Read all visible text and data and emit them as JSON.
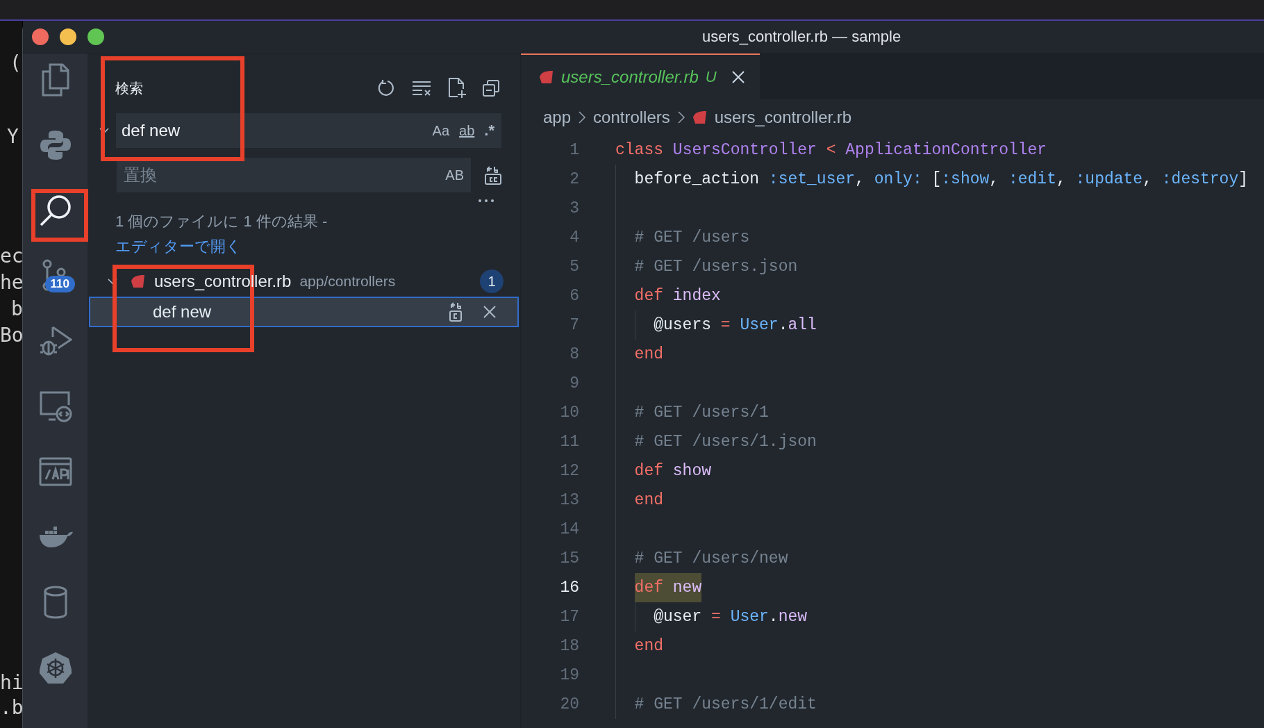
{
  "background_window": {
    "fragments": [
      "(",
      "Y",
      "ec",
      "he",
      "b",
      "Bo",
      "hi",
      ".b"
    ]
  },
  "window": {
    "title": "users_controller.rb — sample"
  },
  "activity_bar": [
    {
      "kind": "files",
      "selected": false
    },
    {
      "kind": "python",
      "selected": false
    },
    {
      "kind": "search",
      "selected": true
    },
    {
      "kind": "source_control",
      "selected": false,
      "badge": "110"
    },
    {
      "kind": "run_debug",
      "selected": false
    },
    {
      "kind": "remote",
      "selected": false
    },
    {
      "kind": "api",
      "selected": false
    },
    {
      "kind": "docker",
      "selected": false
    },
    {
      "kind": "database",
      "selected": false
    },
    {
      "kind": "kubernetes",
      "selected": false
    }
  ],
  "search_panel": {
    "title": "検索",
    "search": {
      "value": "def new",
      "toggles": [
        "Aa",
        "ab",
        ".*"
      ]
    },
    "replace_expanded": true,
    "replace": {
      "placeholder": "置換",
      "toggle": "AB"
    },
    "message": "1 個のファイルに 1 件の結果 -",
    "message_link": "エディターで開く",
    "files": [
      {
        "name": "users_controller.rb",
        "path": "app/controllers",
        "count": "1",
        "expanded": true,
        "matches": [
          {
            "text": "def new",
            "selected": true
          }
        ]
      }
    ]
  },
  "tabs": [
    {
      "name": "users_controller.rb",
      "status": "U",
      "selected": true
    }
  ],
  "breadcrumbs": [
    "app",
    "controllers",
    "users_controller.rb"
  ],
  "code": [
    {
      "n": "1",
      "current": false,
      "tokens": [
        {
          "kind": "kw",
          "text": "class "
        },
        {
          "kind": "cls",
          "text": "UsersController"
        },
        {
          "kind": "op",
          "text": " < "
        },
        {
          "kind": "cls",
          "text": "ApplicationController"
        }
      ]
    },
    {
      "n": "2",
      "current": false,
      "tokens": [
        {
          "kind": "plain",
          "text": "  before_action "
        },
        {
          "kind": "sym",
          "text": ":set_user"
        },
        {
          "kind": "plain",
          "text": ", "
        },
        {
          "kind": "sym",
          "text": "only:"
        },
        {
          "kind": "plain",
          "text": " ["
        },
        {
          "kind": "sym",
          "text": ":show"
        },
        {
          "kind": "plain",
          "text": ", "
        },
        {
          "kind": "sym",
          "text": ":edit"
        },
        {
          "kind": "plain",
          "text": ", "
        },
        {
          "kind": "sym",
          "text": ":update"
        },
        {
          "kind": "plain",
          "text": ", "
        },
        {
          "kind": "sym",
          "text": ":destroy"
        },
        {
          "kind": "plain",
          "text": "]"
        }
      ]
    },
    {
      "n": "3",
      "current": false
    },
    {
      "n": "4",
      "current": false,
      "tokens": [
        {
          "kind": "comment",
          "text": "  # GET /users"
        }
      ]
    },
    {
      "n": "5",
      "current": false,
      "tokens": [
        {
          "kind": "comment",
          "text": "  # GET /users.json"
        }
      ]
    },
    {
      "n": "6",
      "current": false,
      "tokens": [
        {
          "kind": "kw",
          "text": "  def "
        },
        {
          "kind": "fn",
          "text": "index"
        }
      ]
    },
    {
      "n": "7",
      "current": false,
      "tokens": [
        {
          "kind": "plain",
          "text": "    @users "
        },
        {
          "kind": "op",
          "text": "="
        },
        {
          "kind": "const",
          "text": " User"
        },
        {
          "kind": "plain",
          "text": "."
        },
        {
          "kind": "fn",
          "text": "all"
        }
      ]
    },
    {
      "n": "8",
      "current": false,
      "tokens": [
        {
          "kind": "kw",
          "text": "  end"
        }
      ]
    },
    {
      "n": "9",
      "current": false
    },
    {
      "n": "10",
      "current": false,
      "tokens": [
        {
          "kind": "comment",
          "text": "  # GET /users/1"
        }
      ]
    },
    {
      "n": "11",
      "current": false,
      "tokens": [
        {
          "kind": "comment",
          "text": "  # GET /users/1.json"
        }
      ]
    },
    {
      "n": "12",
      "current": false,
      "tokens": [
        {
          "kind": "kw",
          "text": "  def "
        },
        {
          "kind": "fn",
          "text": "show"
        }
      ]
    },
    {
      "n": "13",
      "current": false,
      "tokens": [
        {
          "kind": "kw",
          "text": "  end"
        }
      ]
    },
    {
      "n": "14",
      "current": false
    },
    {
      "n": "15",
      "current": false,
      "tokens": [
        {
          "kind": "comment",
          "text": "  # GET /users/new"
        }
      ]
    },
    {
      "n": "16",
      "current": true,
      "tokens": [
        {
          "kind": "kw",
          "text": "  def "
        },
        {
          "kind": "fn",
          "text": "new",
          "match": true
        }
      ]
    },
    {
      "n": "17",
      "current": false,
      "tokens": [
        {
          "kind": "plain",
          "text": "    @user "
        },
        {
          "kind": "op",
          "text": "="
        },
        {
          "kind": "const",
          "text": " User"
        },
        {
          "kind": "plain",
          "text": "."
        },
        {
          "kind": "fn",
          "text": "new"
        }
      ]
    },
    {
      "n": "18",
      "current": false,
      "tokens": [
        {
          "kind": "kw",
          "text": "  end"
        }
      ]
    },
    {
      "n": "19",
      "current": false
    },
    {
      "n": "20",
      "current": false,
      "tokens": [
        {
          "kind": "comment",
          "text": "  # GET /users/1/edit"
        }
      ]
    }
  ],
  "annotations": [
    {
      "kind": "search_box"
    },
    {
      "kind": "activity_search"
    },
    {
      "kind": "result"
    }
  ]
}
